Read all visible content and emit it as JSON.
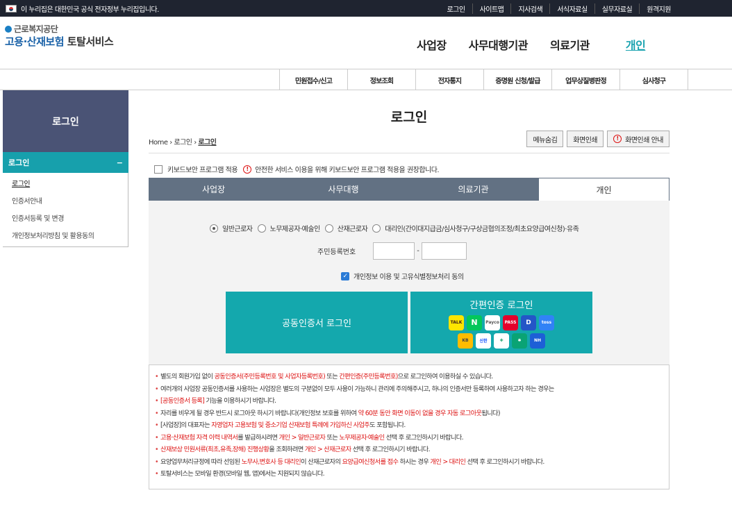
{
  "gov_banner": "이 누리집은 대한민국 공식 전자정부 누리집입니다.",
  "top_links": [
    "로그인",
    "사이트맵",
    "지사검색",
    "서식자료실",
    "실무자료실",
    "원격지원"
  ],
  "logo": {
    "org": "근로복지공단",
    "service_prefix": "고용·산재보험",
    "service_suffix": "토탈서비스"
  },
  "main_nav": [
    "사업장",
    "사무대행기관",
    "의료기관",
    "개인"
  ],
  "sub_nav": [
    "민원접수/신고",
    "정보조회",
    "전자통지",
    "증명원 신청/발급",
    "업무상질병판정",
    "심사청구"
  ],
  "sidebar": {
    "title": "로그인",
    "section": "로그인",
    "toggle": "−",
    "items": [
      "로그인",
      "인증서안내",
      "인증서등록 및 변경",
      "개인정보처리방침 및 활용동의"
    ]
  },
  "page": {
    "title": "로그인",
    "breadcrumb": [
      "Home",
      "로그인",
      "로그인"
    ],
    "buttons": {
      "hide_menu": "메뉴숨김",
      "print": "화면인쇄",
      "print_guide": "화면인쇄 안내"
    },
    "keyboard_security": "키보드보안 프로그램 적용",
    "keyboard_notice": "안전한 서비스 이용을 위해 키보드보안 프로그램 적용을 권장합니다."
  },
  "tabs": [
    "사업장",
    "사무대행",
    "의료기관",
    "개인"
  ],
  "login_form": {
    "radios": [
      "일반근로자",
      "노무제공자·예술인",
      "산재근로자",
      "대리인(간이대지급금/심사청구/구상금협의조정/최초요양급여신청)·유족"
    ],
    "rrn_label": "주민등록번호",
    "rrn_separator": "-",
    "agree_label": "개인정보 이용 및 고유식별정보처리 동의",
    "cert_login": "공동인증서 로그인",
    "simple_login": "간편인증 로그인",
    "simple_providers": [
      "TALK",
      "N",
      "Payco",
      "PASS",
      "D",
      "toss",
      "KB",
      "신한",
      "NH"
    ]
  },
  "notes": [
    [
      "별도의 회원가입 없이 ",
      "공동인증서(주민등록번호 및 사업자등록번호)",
      " 또는 ",
      "간편인증(주민등록번호)",
      "으로 로그인하여 이용하실 수 있습니다."
    ],
    [
      "여러개의 사업장 공동인증서를 사용하는 사업장은 별도의 구분없이 모두 사용이 가능하니 관리에 주의해주시고, 하나의 인증서만 등록하여 사용하고자 하는 경우는"
    ],
    [
      "[공동인증서 등록]",
      " 기능을 이용하시기 바랍니다."
    ],
    [
      "자리를 비우게 될 경우 반드시 로그아웃 하시기 바랍니다(개인정보 보호를 위하여 ",
      "약 60분 동안 화면 이동이 없을 경우 자동 로그아웃",
      "됩니다)"
    ],
    [
      "[사업장]의 대표자는 ",
      "자영업자 고용보험 및 중소기업 산재보험 특례에 가입하신 사업주",
      "도 포함됩니다."
    ],
    [
      "고용·산재보험 자격 이력 내역서",
      "를 발급하시려면 ",
      "개인 > 일반근로자",
      " 또는 ",
      "노무제공자·예술인",
      " 선택 후 로그인하시기 바랍니다."
    ],
    [
      "산재보상 민원서류(최초,유족,장해) 진행상황",
      "을 조회하려면 ",
      "개인 > 산재근로자",
      " 선택 후 로그인하시기 바랍니다."
    ],
    [
      "요양업무처리규정에 따라 선임된 ",
      "노무사,변호사 등 대리인",
      "이 산재근로자의 ",
      "요양급여신청서를 접수",
      " 하시는 경우 ",
      "개인 > 대리인",
      " 선택 후 로그인하시기 바랍니다."
    ],
    [
      "토탈서비스는 모바일 환경(모바일 웹, 앱)에서는 지원되지 않습니다."
    ]
  ],
  "colors": {
    "accent": "#14a8ad",
    "sidebar_title_bg": "#4a5375",
    "tab_bg": "#627183",
    "warning": "#dd1111"
  }
}
